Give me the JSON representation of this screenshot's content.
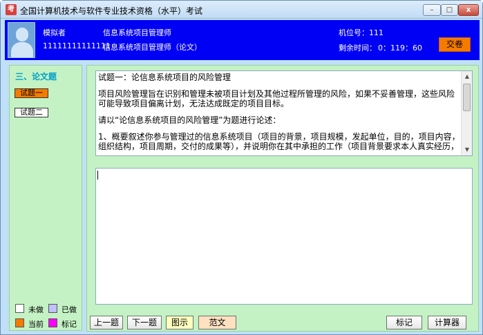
{
  "window": {
    "title": "全国计算机技术与软件专业技术资格（水平）考试",
    "icon_glyph": "考",
    "controls": {
      "minimize": "–",
      "maximize": "□",
      "close": "x"
    }
  },
  "header": {
    "name_label": "模拟者",
    "id_number": "11111111111111",
    "exam_name": "信息系统项目管理师",
    "exam_paper": "信息系统项目管理师（论文）",
    "seat_label": "机位号：111",
    "time_label": "剩余时间：",
    "time_value": "0：119：60",
    "submit_label": "交卷",
    "bg_color": "#0000f5"
  },
  "sidebar": {
    "section_title": "三、论文题",
    "questions": [
      {
        "label": "试题一",
        "state": "current"
      },
      {
        "label": "试题二",
        "state": "unanswered"
      }
    ],
    "legend": [
      {
        "label": "未做",
        "color": "#ffffff"
      },
      {
        "label": "已做",
        "color": "#c0c0ff"
      },
      {
        "label": "当前",
        "color": "#f57a00"
      },
      {
        "label": "标记",
        "color": "#ff00ff"
      }
    ]
  },
  "question": {
    "title": "试题一：论信息系统项目的风险管理",
    "para1": "项目风险管理旨在识别和管理未被项目计划及其他过程所管理的风险，如果不妥善管理，这些风险可能导致项目偏离计划，无法达成既定的项目目标。",
    "para2": "请以“论信息系统项目的风险管理”为题进行论述：",
    "para3": "1、概要叙述你参与管理过的信息系统项目（项目的背景，项目规模，发起单位，目的，项目内容，组织结构，项目周期，交付的成果等），并说明你在其中承担的工作（项目背景要求本人真实经历，"
  },
  "answer": {
    "value": ""
  },
  "toolbar": {
    "prev": "上一题",
    "next": "下一题",
    "figure": "图示",
    "sample": "范文",
    "mark": "标记",
    "calculator": "计算器"
  }
}
